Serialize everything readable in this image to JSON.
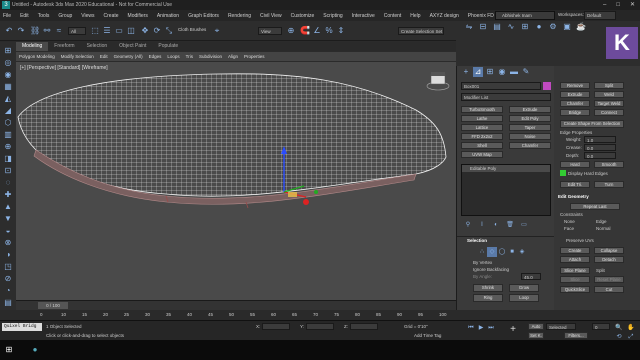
{
  "window": {
    "title": "Untitled - Autodesk 3ds Max 2020 Educational - Not for Commercial Use"
  },
  "menu": [
    "File",
    "Edit",
    "Tools",
    "Group",
    "Views",
    "Create",
    "Modifiers",
    "Animation",
    "Graph Editors",
    "Rendering",
    "Civil View",
    "Customize",
    "Scripting",
    "Interactive",
    "Content",
    "Help",
    "AXYZ design",
    "Phoenix FD"
  ],
  "user": {
    "name": "Abhishek Inam",
    "workspaces_label": "Workspaces:",
    "workspace": "Default"
  },
  "toolbar": {
    "filter": "All",
    "view": "View",
    "selection_set": "Create Selection Set",
    "cloth_brushes": "Cloth Brushes"
  },
  "ribbon": {
    "tabs": [
      "Modeling",
      "Freeform",
      "Selection",
      "Object Paint",
      "Populate"
    ],
    "subtabs": [
      "Polygon Modeling",
      "Modify Selection",
      "Edit",
      "Geometry (All)",
      "Edges",
      "Loops",
      "Tris",
      "Subdivision",
      "Align",
      "Properties"
    ]
  },
  "viewport": {
    "label": "[+] [Perspective] [Standard] [Wireframe]"
  },
  "cmd": {
    "object_name": "Box001",
    "modifier_list": "Modifier List",
    "mod_buttons": [
      [
        "TurboSmooth",
        "Extrude"
      ],
      [
        "Lathe",
        "Edit Poly"
      ],
      [
        "Lattice",
        "Taper"
      ],
      [
        "FFD 2x2x2",
        "Noise"
      ],
      [
        "Shell",
        "Chamfer"
      ],
      [
        "UVW Map",
        ""
      ]
    ],
    "stack_item": "Editable Poly",
    "selection_header": "Selection",
    "by_vertex": "By Vertex",
    "ignore_backfacing": "Ignore Backfacing",
    "by_angle": "By Angle:",
    "angle_value": "45.0",
    "shrink": "Shrink",
    "grow": "Grow",
    "ring": "Ring",
    "loop": "Loop"
  },
  "cmd2": {
    "top_buttons": [
      [
        "Remove",
        "Split"
      ],
      [
        "Extrude",
        "Weld"
      ],
      [
        "Chamfer",
        "Target Weld"
      ],
      [
        "Bridge",
        "Connect"
      ]
    ],
    "create_shape": "Create Shape From Selection",
    "edge_props": "Edge Properties",
    "weight_label": "Weight:",
    "weight": "1.0",
    "crease_label": "Crease:",
    "crease": "0.0",
    "depth_label": "Depth:",
    "depth": "0.0",
    "hard": "Hard",
    "smooth": "Smooth",
    "display_hard": "Display Hard Edges",
    "edit_tri": "Edit Tri.",
    "turn": "Turn",
    "edit_geometry": "Edit Geometry",
    "repeat_last": "Repeat Last",
    "constraints": "Constraints",
    "none": "None",
    "edge": "Edge",
    "face": "Face",
    "normal": "Normal",
    "preserve_uvs": "Preserve UVs",
    "create": "Create",
    "collapse": "Collapse",
    "attach": "Attach",
    "detach": "Detach",
    "slice_plane": "Slice Plane",
    "split": "Split",
    "slice": "Slice",
    "reset_plane": "Reset Plane",
    "quickslice": "QuickSlice",
    "cut": "Cut"
  },
  "timeline": {
    "frame": "0 / 100"
  },
  "ruler": [
    "0",
    "10",
    "15",
    "20",
    "25",
    "30",
    "35",
    "40",
    "45",
    "50",
    "55",
    "60",
    "65",
    "70",
    "75",
    "80",
    "85",
    "90",
    "95",
    "100"
  ],
  "status": {
    "script": "Quixel Bridg",
    "selected": "1 Object Selected",
    "hint": "Click or click-and-drag to select objects",
    "x_label": "X:",
    "y_label": "Y:",
    "z_label": "Z:",
    "grid": "Grid = 0'10\"",
    "add_time_tag": "Add Time Tag",
    "auto": "Auto",
    "set_key": "Set K.",
    "selected_mode": "Selected",
    "filters": "Filters...",
    "frame_value": "0"
  }
}
